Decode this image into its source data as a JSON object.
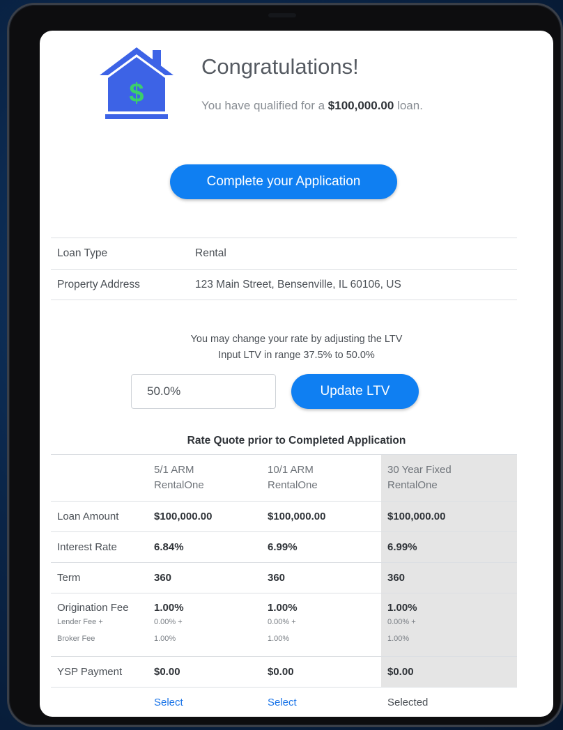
{
  "header": {
    "title": "Congratulations!",
    "qualified_prefix": "You have qualified for a ",
    "qualified_amount": "$100,000.00",
    "qualified_suffix": " loan."
  },
  "cta_label": "Complete your Application",
  "loan_info": [
    {
      "label": "Loan Type",
      "value": "Rental"
    },
    {
      "label": "Property Address",
      "value": "123 Main Street, Bensenville, IL 60106, US"
    }
  ],
  "ltv": {
    "note_line1": "You may change your rate by adjusting the LTV",
    "note_line2": "Input LTV in range 37.5% to 50.0%",
    "input_value": "50.0%",
    "button_label": "Update LTV"
  },
  "rate_quote": {
    "title": "Rate Quote prior to Completed Application",
    "products": [
      {
        "line1": "5/1 ARM",
        "line2": "RentalOne"
      },
      {
        "line1": "10/1 ARM",
        "line2": "RentalOne"
      },
      {
        "line1": "30 Year Fixed",
        "line2": "RentalOne"
      }
    ],
    "rows": {
      "loan_amount": {
        "label": "Loan Amount",
        "values": [
          "$100,000.00",
          "$100,000.00",
          "$100,000.00"
        ]
      },
      "interest_rate": {
        "label": "Interest Rate",
        "values": [
          "6.84%",
          "6.99%",
          "6.99%"
        ]
      },
      "term": {
        "label": "Term",
        "values": [
          "360",
          "360",
          "360"
        ]
      },
      "origination_fee": {
        "label": "Origination Fee",
        "sublabel1": "Lender Fee +",
        "sublabel2": "Broker Fee",
        "values": [
          "1.00%",
          "1.00%",
          "1.00%"
        ],
        "lender": [
          "0.00% +",
          "0.00% +",
          "0.00% +"
        ],
        "broker": [
          "1.00%",
          "1.00%",
          "1.00%"
        ]
      },
      "ysp_payment": {
        "label": "YSP Payment",
        "values": [
          "$0.00",
          "$0.00",
          "$0.00"
        ]
      }
    },
    "actions": [
      "Select",
      "Select",
      "Selected"
    ]
  },
  "colors": {
    "primary": "#0f7ff2",
    "house": "#3d63e6",
    "dollar": "#3bcf6b",
    "selected_col_bg": "#e5e5e5"
  },
  "icons": {
    "house": "house-dollar-icon"
  }
}
